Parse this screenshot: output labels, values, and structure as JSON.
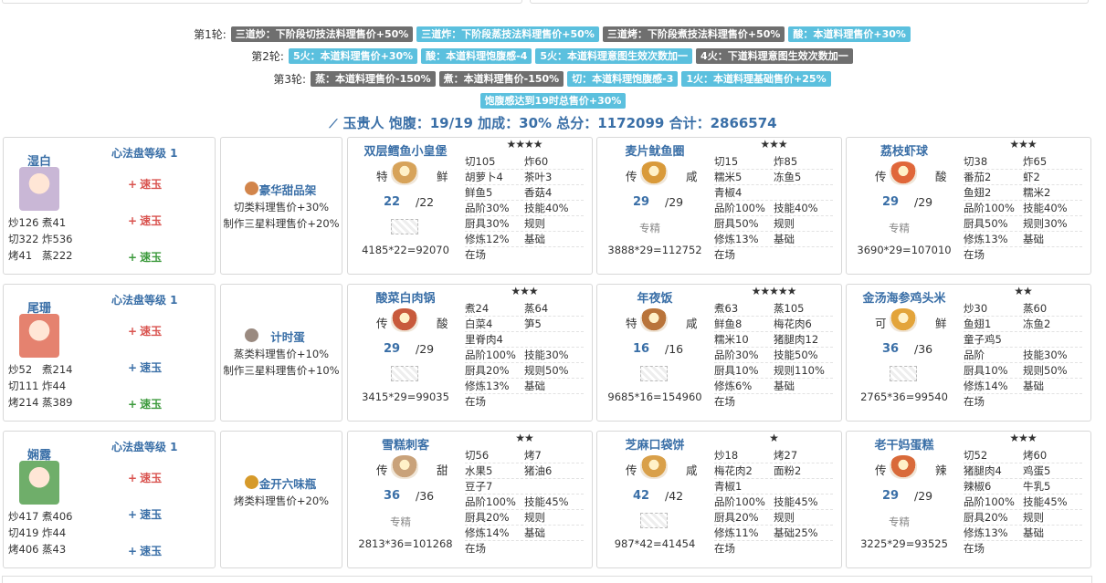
{
  "rounds": [
    {
      "label": "第1轮:",
      "tags": [
        {
          "text": "三道炒：下阶段切技法料理售价+50%",
          "color": "gray"
        },
        {
          "text": "三道炸：下阶段蒸技法料理售价+50%",
          "color": "blue"
        },
        {
          "text": "三道烤：下阶段煮技法料理售价+50%",
          "color": "gray"
        },
        {
          "text": "酸：本道料理售价+30%",
          "color": "blue"
        }
      ]
    },
    {
      "label": "第2轮:",
      "tags": [
        {
          "text": "5火：本道料理售价+30%",
          "color": "blue"
        },
        {
          "text": "酸：本道料理饱腹感-4",
          "color": "blue"
        },
        {
          "text": "5火：本道料理意图生效次数加一",
          "color": "blue"
        },
        {
          "text": "4火：下道料理意图生效次数加一",
          "color": "gray"
        }
      ]
    },
    {
      "label": "第3轮:",
      "tags": [
        {
          "text": "蒸：本道料理售价-150%",
          "color": "gray"
        },
        {
          "text": "煮：本道料理售价-150%",
          "color": "gray"
        },
        {
          "text": "切：本道料理饱腹感-3",
          "color": "blue"
        },
        {
          "text": "1火：本道料理基础售价+25%",
          "color": "blue"
        }
      ]
    },
    {
      "label": "",
      "tags": [
        {
          "text": "饱腹感达到19时总售价+30%",
          "color": "blue"
        }
      ]
    }
  ],
  "summary": {
    "icon": "rank-icon",
    "text": "玉贵人 饱腹：19/19 加成：30% 总分：1172099 合计：2866574"
  },
  "rows": [
    {
      "chef": {
        "name": "湿白",
        "level": "心法盘等级 1",
        "avatarColor": "#c9b7d6",
        "jades": [
          {
            "sign": "+",
            "label": "速玉",
            "color": "#d9534f"
          },
          {
            "sign": "+",
            "label": "速玉",
            "color": "#d9534f"
          },
          {
            "sign": "+",
            "label": "速玉",
            "color": "#3c9a3c"
          }
        ],
        "skills": [
          [
            "炒126",
            "煮41"
          ],
          [
            "切322",
            "炸536"
          ],
          [
            "烤41",
            "蒸222"
          ]
        ]
      },
      "equip": {
        "icon": "cake-icon",
        "iconColor": "#d2854b",
        "name": "豪华甜品架",
        "effects": [
          "切类料理售价+30%",
          "制作三星料理售价+20%"
        ]
      },
      "dishes": [
        {
          "name": "双层鳕鱼小皇堡",
          "rarity": "★★★★",
          "left": "特",
          "right": "鲜",
          "imgColor": "#d7a35a",
          "qty": "22",
          "qmax": "/22",
          "special": "",
          "noimg": true,
          "price": "4185*22=92070",
          "grid": [
            [
              "切105",
              "炸60"
            ],
            [
              "胡萝卜4",
              "茶叶3"
            ],
            [
              "鲜鱼5",
              "香菇4"
            ],
            [
              "品阶30%",
              "技能40%"
            ],
            [
              "厨具30%",
              "规则"
            ],
            [
              "修炼12%",
              "基础"
            ],
            [
              "在场",
              ""
            ]
          ]
        },
        {
          "name": "麦片鱿鱼圈",
          "rarity": "★★★",
          "left": "传",
          "right": "咸",
          "imgColor": "#d99a3a",
          "qty": "29",
          "qmax": "/29",
          "special": "专精",
          "noimg": false,
          "price": "3888*29=112752",
          "grid": [
            [
              "切15",
              "炸85"
            ],
            [
              "糯米5",
              "冻鱼5"
            ],
            [
              "青椒4",
              ""
            ],
            [
              "品阶100%",
              "技能40%"
            ],
            [
              "厨具50%",
              "规则"
            ],
            [
              "修炼13%",
              "基础"
            ],
            [
              "在场",
              ""
            ]
          ]
        },
        {
          "name": "荔枝虾球",
          "rarity": "★★★",
          "left": "传",
          "right": "酸",
          "imgColor": "#e0673a",
          "qty": "29",
          "qmax": "/29",
          "special": "专精",
          "noimg": false,
          "price": "3690*29=107010",
          "grid": [
            [
              "切38",
              "炸65"
            ],
            [
              "番茄2",
              "虾2"
            ],
            [
              "鱼翅2",
              "糯米2"
            ],
            [
              "品阶100%",
              "技能40%"
            ],
            [
              "厨具50%",
              "规则30%"
            ],
            [
              "修炼13%",
              "基础"
            ],
            [
              "在场",
              ""
            ]
          ]
        }
      ]
    },
    {
      "chef": {
        "name": "尾珊",
        "level": "心法盘等级 1",
        "avatarColor": "#e5826f",
        "jades": [
          {
            "sign": "+",
            "label": "速玉",
            "color": "#d9534f"
          },
          {
            "sign": "+",
            "label": "速玉",
            "color": "#3a6fa7"
          },
          {
            "sign": "+",
            "label": "速玉",
            "color": "#3c9a3c"
          }
        ],
        "skills": [
          [
            "炒52",
            "煮214"
          ],
          [
            "切111",
            "炸44"
          ],
          [
            "烤214",
            "蒸389"
          ]
        ]
      },
      "equip": {
        "icon": "egg-icon",
        "iconColor": "#9a8a80",
        "name": "计时蛋",
        "effects": [
          "蒸类料理售价+10%",
          "制作三星料理售价+10%"
        ]
      },
      "dishes": [
        {
          "name": "酸菜白肉锅",
          "rarity": "★★★",
          "left": "传",
          "right": "酸",
          "imgColor": "#c85a3c",
          "qty": "29",
          "qmax": "/29",
          "special": "",
          "noimg": true,
          "price": "3415*29=99035",
          "grid": [
            [
              "煮24",
              "蒸64"
            ],
            [
              "白菜4",
              "笋5"
            ],
            [
              "里脊肉4",
              ""
            ],
            [
              "品阶100%",
              "技能30%"
            ],
            [
              "厨具20%",
              "规则50%"
            ],
            [
              "修炼13%",
              "基础"
            ],
            [
              "在场",
              ""
            ]
          ]
        },
        {
          "name": "年夜饭",
          "rarity": "★★★★★",
          "left": "特",
          "right": "咸",
          "imgColor": "#b9743a",
          "qty": "16",
          "qmax": "/16",
          "special": "",
          "noimg": true,
          "price": "9685*16=154960",
          "grid": [
            [
              "煮63",
              "蒸105"
            ],
            [
              "鲜鱼8",
              "梅花肉6"
            ],
            [
              "糯米10",
              "猪腿肉12"
            ],
            [
              "品阶30%",
              "技能50%"
            ],
            [
              "厨具10%",
              "规则110%"
            ],
            [
              "修炼6%",
              "基础"
            ],
            [
              "在场",
              ""
            ]
          ]
        },
        {
          "name": "金汤海参鸡头米",
          "rarity": "★★",
          "left": "可",
          "right": "鲜",
          "imgColor": "#e3a43a",
          "qty": "36",
          "qmax": "/36",
          "special": "",
          "noimg": true,
          "price": "2765*36=99540",
          "grid": [
            [
              "炒30",
              "蒸60"
            ],
            [
              "鱼翅1",
              "冻鱼2"
            ],
            [
              "童子鸡5",
              ""
            ],
            [
              "品阶",
              "技能30%"
            ],
            [
              "厨具10%",
              "规则50%"
            ],
            [
              "修炼14%",
              "基础"
            ],
            [
              "在场",
              ""
            ]
          ]
        }
      ]
    },
    {
      "chef": {
        "name": "娴露",
        "level": "心法盘等级 1",
        "avatarColor": "#6fae6a",
        "jades": [
          {
            "sign": "+",
            "label": "速玉",
            "color": "#d9534f"
          },
          {
            "sign": "+",
            "label": "速玉",
            "color": "#3a6fa7"
          },
          {
            "sign": "+",
            "label": "速玉",
            "color": "#3a6fa7"
          }
        ],
        "skills": [
          [
            "炒417",
            "煮406"
          ],
          [
            "切419",
            "炸44"
          ],
          [
            "烤406",
            "蒸43"
          ]
        ]
      },
      "equip": {
        "icon": "bottle-icon",
        "iconColor": "#d69a2a",
        "name": "金开六味瓶",
        "effects": [
          "烤类料理售价+20%"
        ]
      },
      "dishes": [
        {
          "name": "雪糕刺客",
          "rarity": "★★",
          "left": "传",
          "right": "甜",
          "imgColor": "#c9a27a",
          "qty": "36",
          "qmax": "/36",
          "special": "专精",
          "noimg": false,
          "price": "2813*36=101268",
          "grid": [
            [
              "切56",
              "烤7"
            ],
            [
              "水果5",
              "猪油6"
            ],
            [
              "豆子7",
              ""
            ],
            [
              "品阶100%",
              "技能45%"
            ],
            [
              "厨具20%",
              "规则"
            ],
            [
              "修炼14%",
              "基础"
            ],
            [
              "在场",
              ""
            ]
          ]
        },
        {
          "name": "芝麻口袋饼",
          "rarity": "★",
          "left": "传",
          "right": "咸",
          "imgColor": "#d9a04a",
          "qty": "42",
          "qmax": "/42",
          "special": "",
          "noimg": true,
          "price": "987*42=41454",
          "grid": [
            [
              "炒18",
              "烤27"
            ],
            [
              "梅花肉2",
              "面粉2"
            ],
            [
              "青椒1",
              ""
            ],
            [
              "品阶100%",
              "技能45%"
            ],
            [
              "厨具20%",
              "规则"
            ],
            [
              "修炼11%",
              "基础25%"
            ],
            [
              "在场",
              ""
            ]
          ]
        },
        {
          "name": "老干妈蛋糕",
          "rarity": "★★★",
          "left": "传",
          "right": "辣",
          "imgColor": "#d96a3a",
          "qty": "29",
          "qmax": "/29",
          "special": "专精",
          "noimg": false,
          "price": "3225*29=93525",
          "grid": [
            [
              "切52",
              "烤60"
            ],
            [
              "猪腿肉4",
              "鸡蛋5"
            ],
            [
              "辣椒6",
              "牛乳5"
            ],
            [
              "品阶100%",
              "技能45%"
            ],
            [
              "厨具20%",
              "规则"
            ],
            [
              "修炼13%",
              "基础"
            ],
            [
              "在场",
              ""
            ]
          ]
        }
      ]
    }
  ]
}
